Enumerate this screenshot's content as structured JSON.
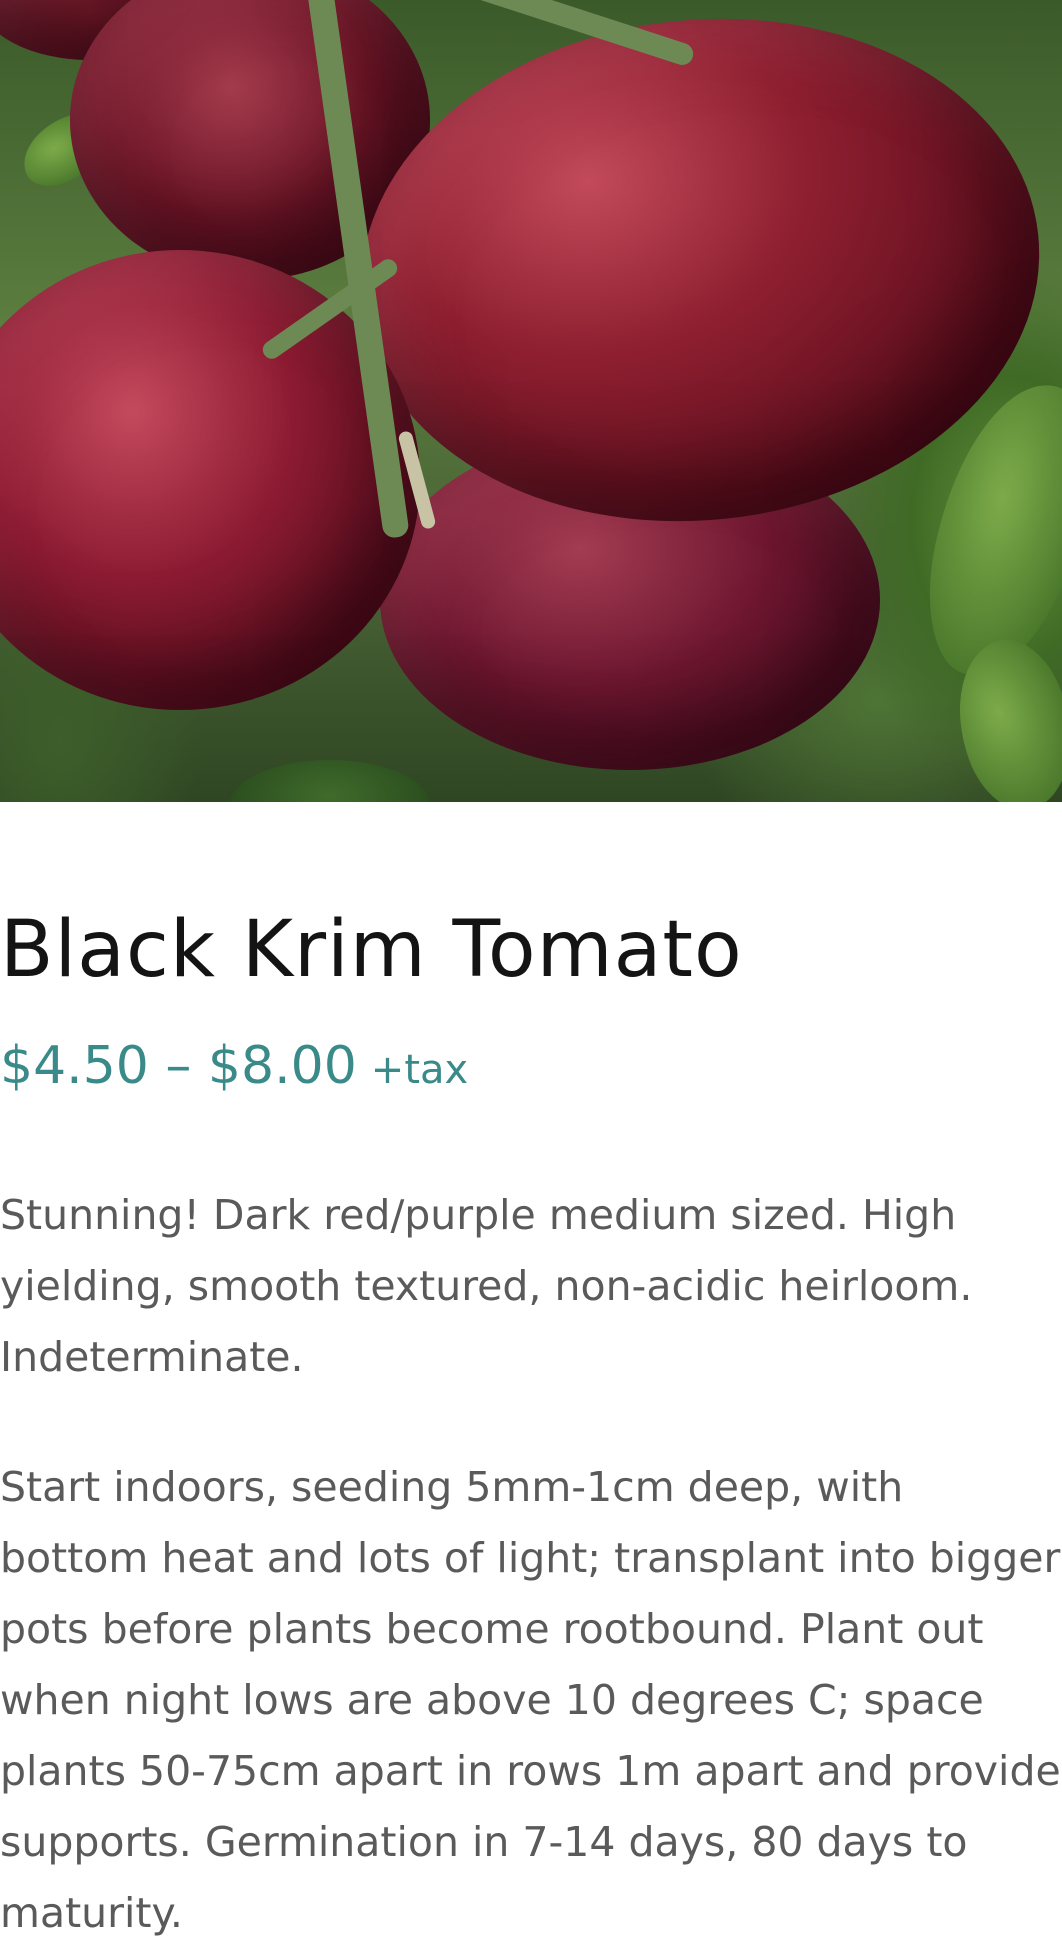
{
  "product": {
    "title": "Black Krim Tomato",
    "price_range": "$4.50 – $8.00",
    "tax_suffix": "+tax",
    "description": [
      "Stunning! Dark red/purple medium sized. High yielding, smooth textured, non-acidic heirloom. Indeterminate.",
      "Start indoors, seeding 5mm-1cm deep, with bottom heat and lots of light; transplant into bigger pots before plants become rootbound. Plant out when night lows are above 10 degrees C; space plants 50-75cm apart in rows 1m apart and provide supports. Germination in 7-14 days, 80 days to maturity."
    ]
  },
  "colors": {
    "title": "#141414",
    "price": "#3a8a89",
    "body_text": "#5a5a5a",
    "background": "#ffffff"
  }
}
